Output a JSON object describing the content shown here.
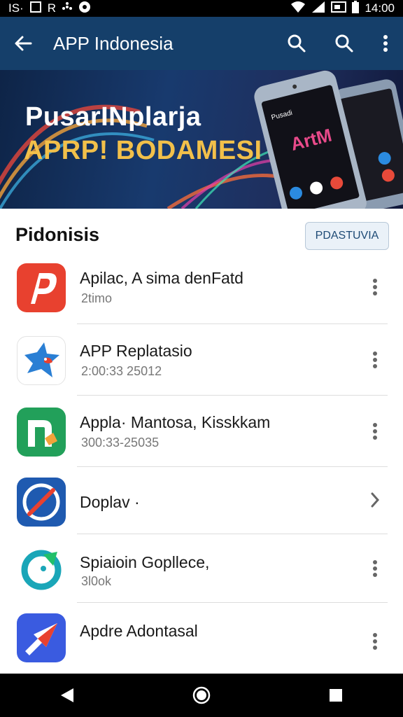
{
  "status_bar": {
    "left_text_1": "IS·",
    "left_text_2": "R",
    "time": "14:00",
    "icons": [
      "sd-card-icon",
      "flower-icon",
      "record-icon",
      "wifi-icon",
      "signal-icon",
      "battery-saver-icon",
      "battery-icon"
    ]
  },
  "app_bar": {
    "title": "APP Indonesia",
    "icons": [
      "back-arrow-icon",
      "search-icon",
      "search-icon",
      "more-vertical-icon"
    ],
    "color": "#153f6a"
  },
  "banner": {
    "line1": "PusarINplarja",
    "line2": "APRP! BODAMESI",
    "line2_color": "#f2c04a",
    "phone_text_1": "Pusadi",
    "phone_text_2": "ArtM"
  },
  "section": {
    "title": "Pidonisis",
    "button_label": "PDASTUVIA"
  },
  "apps": [
    {
      "title": "Apilac, A sima denFatd",
      "subtitle": "2timo",
      "icon": "red-p-app-icon",
      "action": "more-vertical-icon"
    },
    {
      "title": "APP Replatasio",
      "subtitle": "2:00:33 25012",
      "icon": "bird-app-icon",
      "action": "more-vertical-icon"
    },
    {
      "title": "Appla· Mantosa, Kisskkam",
      "subtitle": "300:33-25035",
      "icon": "green-n-app-icon",
      "action": "more-vertical-icon"
    },
    {
      "title": "Doplav ·",
      "subtitle": "",
      "icon": "blue-circle-slash-app-icon",
      "action": "chevron-right-icon"
    },
    {
      "title": "Spiaioin Gopllece,",
      "subtitle": "3l0ok",
      "icon": "teal-ring-app-icon",
      "action": "more-vertical-icon"
    },
    {
      "title": "Apdre Adontasal",
      "subtitle": "",
      "icon": "star-arrow-app-icon",
      "action": "more-vertical-icon"
    }
  ],
  "nav_bar": {
    "icons": [
      "back-triangle-icon",
      "home-circle-icon",
      "recents-square-icon"
    ]
  }
}
